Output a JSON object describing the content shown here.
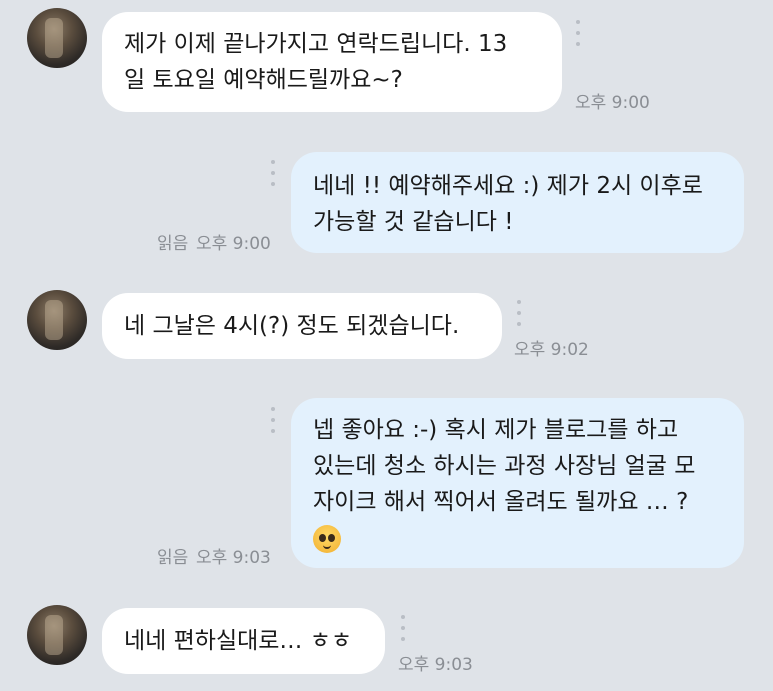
{
  "chat": {
    "messages": [
      {
        "direction": "in",
        "lines": [
          "제가 이제 끝나가지고 연락드립니다. 13",
          "일 토요일 예약해드릴까요~?"
        ],
        "time": "오후 9:00"
      },
      {
        "direction": "out",
        "lines": [
          "네네 !! 예약해주세요 :) 제가 2시 이후로",
          "가능할 것 같습니다 !"
        ],
        "read": "읽음",
        "time": "오후 9:00"
      },
      {
        "direction": "in",
        "lines": [
          "네 그날은 4시(?) 정도 되겠습니다."
        ],
        "time": "오후 9:02"
      },
      {
        "direction": "out",
        "lines": [
          "넵 좋아요 :-) 혹시 제가 블로그를 하고",
          "있는데 청소 하시는 과정 사장님 얼굴 모",
          "자이크 해서 찍어서 올려도 될까요 … ?"
        ],
        "emoji": "pleading-face-emoji",
        "read": "읽음",
        "time": "오후 9:03"
      },
      {
        "direction": "in",
        "lines": [
          "네네 편하실대로… ㅎㅎ"
        ],
        "time": "오후 9:03"
      }
    ]
  }
}
